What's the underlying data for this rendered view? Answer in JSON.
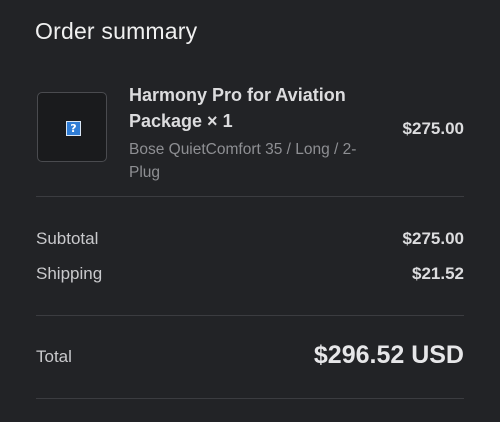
{
  "summary": {
    "title": "Order summary"
  },
  "item": {
    "name": "Harmony Pro for Aviation Package × 1",
    "variant": "Bose QuietComfort 35 / Long / 2-Plug",
    "price": "$275.00",
    "thumbnail_icon": "broken-image-icon",
    "thumbnail_glyph": "?"
  },
  "totals": {
    "subtotal_label": "Subtotal",
    "subtotal_value": "$275.00",
    "shipping_label": "Shipping",
    "shipping_value": "$21.52",
    "total_label": "Total",
    "total_value": "$296.52 USD"
  },
  "colors": {
    "background": "#222326",
    "text_primary": "#dcdcde",
    "text_secondary": "#8e8f93",
    "divider": "#3b3c40",
    "placeholder_icon": "#2f7dd6"
  }
}
